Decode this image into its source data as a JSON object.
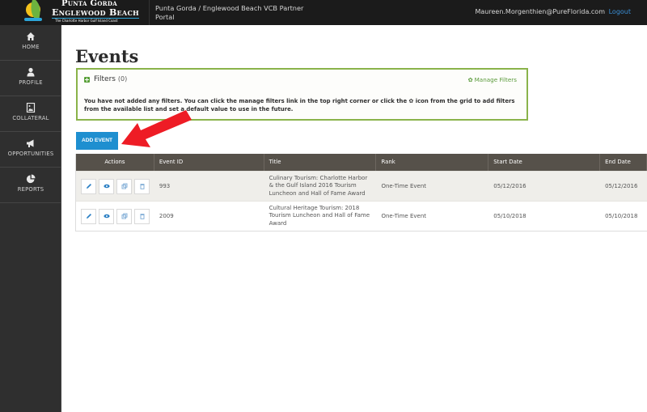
{
  "header": {
    "brand_line1": "Punta Gorda",
    "brand_line2": "Englewood Beach",
    "brand_tagline": "The Charlotte Harbor Gulf Island Coast",
    "portal_title": "Punta Gorda / Englewood Beach VCB Partner Portal",
    "user_email": "Maureen.Morgenthien@PureFlorida.com",
    "logout_label": "Logout"
  },
  "sidebar": {
    "items": [
      {
        "label": "HOME",
        "icon": "home-icon"
      },
      {
        "label": "PROFILE",
        "icon": "user-icon"
      },
      {
        "label": "COLLATERAL",
        "icon": "image-file-icon"
      },
      {
        "label": "OPPORTUNITIES",
        "icon": "megaphone-icon"
      },
      {
        "label": "REPORTS",
        "icon": "pie-chart-icon"
      }
    ]
  },
  "main": {
    "page_title": "Events",
    "filters": {
      "title": "Filters",
      "count": "(0)",
      "manage_label": "Manage Filters",
      "message_part1": "You have not added any filters. You can click the manage filters link in the top right corner or click the",
      "message_part2": "icon from the grid to add filters from the available list and set a default value to use in the future."
    },
    "add_event_label": "ADD EVENT",
    "annotation_arrow_color": "#ee1c25",
    "table": {
      "columns": [
        "Actions",
        "Event ID",
        "Title",
        "Rank",
        "Start Date",
        "End Date"
      ],
      "rows": [
        {
          "event_id": "993",
          "title": "Culinary Tourism: Charlotte Harbor & the Gulf Island 2016 Tourism Luncheon and Hall of Fame Award",
          "rank": "One-Time Event",
          "start_date": "05/12/2016",
          "end_date": "05/12/2016"
        },
        {
          "event_id": "2009",
          "title": "Cultural Heritage Tourism: 2018 Tourism Luncheon and Hall of Fame Award",
          "rank": "One-Time Event",
          "start_date": "05/10/2018",
          "end_date": "05/10/2018"
        }
      ],
      "row_actions": [
        "edit-icon",
        "view-icon",
        "copy-icon",
        "delete-icon"
      ]
    }
  },
  "colors": {
    "accent_blue": "#1e8fd0",
    "filter_green": "#8ab34a",
    "table_header": "#56514a",
    "sidebar_bg": "#2f2f2f",
    "topbar_bg": "#1b1b1b"
  }
}
